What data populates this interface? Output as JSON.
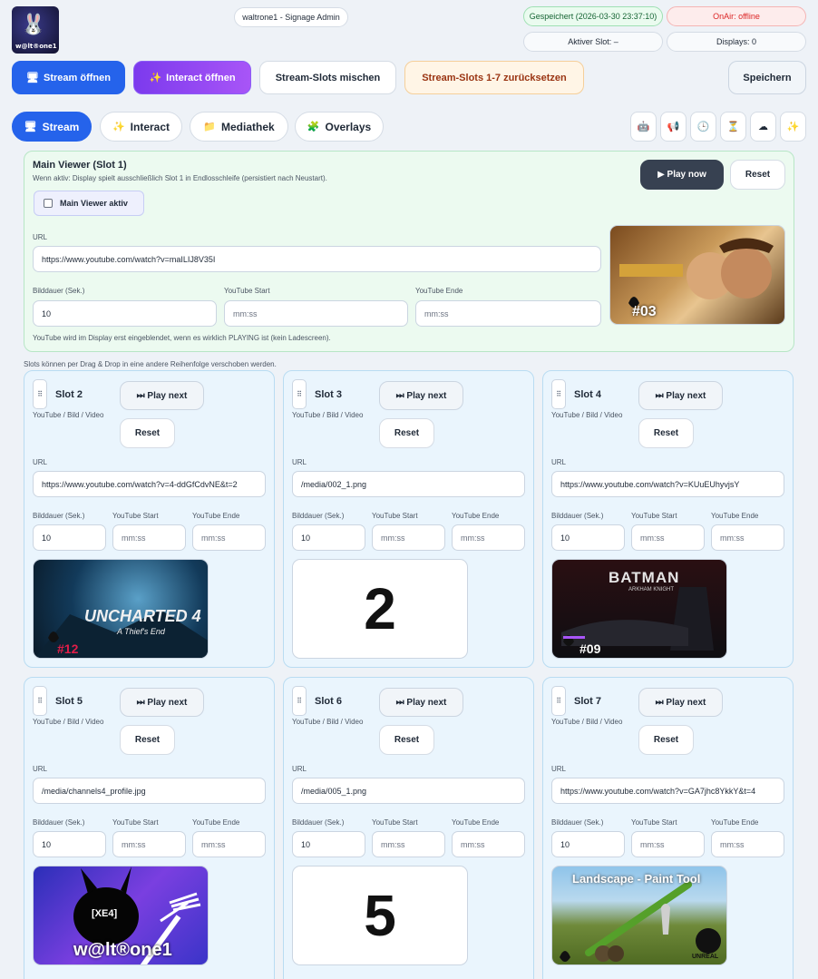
{
  "header": {
    "title": "waltrone1 - Signage Admin",
    "saved_status": "Gespeichert (2026-03-30 23:37:10)",
    "onair_status": "OnAir: offline",
    "active_slot": "Aktiver Slot: –",
    "displays": "Displays: 0",
    "logo_text": "w@lt®one1"
  },
  "toolbar": {
    "stream_open": "Stream öffnen",
    "interact_open": "Interact öffnen",
    "mix_slots": "Stream-Slots mischen",
    "reset_slots": "Stream-Slots 1-7 zurücksetzen",
    "save": "Speichern",
    "stream_open_icon": "monitor-icon",
    "interact_open_icon": "sparkle-icon"
  },
  "tabs": [
    {
      "label": "Stream",
      "icon": "monitor-icon",
      "active": true
    },
    {
      "label": "Interact",
      "icon": "sparkle-icon",
      "active": false
    },
    {
      "label": "Mediathek",
      "icon": "folder-icon",
      "active": false
    },
    {
      "label": "Overlays",
      "icon": "puzzle-icon",
      "active": false
    }
  ],
  "quick_icons": [
    "robot-icon",
    "megaphone-icon",
    "clock-icon",
    "hourglass-icon",
    "cloud-icon",
    "sparkle-icon"
  ],
  "main_viewer": {
    "title": "Main Viewer (Slot 1)",
    "subtitle": "Wenn aktiv: Display spielt ausschließlich Slot 1 in Endlosschleife (persistiert nach Neustart).",
    "checkbox_label": "Main Viewer aktiv",
    "play_now": "▶ Play now",
    "reset": "Reset",
    "url_label": "URL",
    "url": "https://www.youtube.com/watch?v=maILIJ8V35I",
    "duration_label": "Bilddauer (Sek.)",
    "duration": "10",
    "yt_start_label": "YouTube Start",
    "yt_start_placeholder": "mm:ss",
    "yt_end_label": "YouTube Ende",
    "yt_end_placeholder": "mm:ss",
    "hint": "YouTube wird im Display erst eingeblendet, wenn es wirklich PLAYING ist (kein Ladescreen).",
    "thumb_badge": "#03"
  },
  "slots_note": "Slots können per Drag & Drop in eine andere Reihenfolge verschoben werden.",
  "slot_common": {
    "type": "YouTube / Bild / Video",
    "play_next": "⏭ Play next",
    "reset": "Reset",
    "url_label": "URL",
    "duration_label": "Bilddauer (Sek.)",
    "yt_start_label": "YouTube Start",
    "yt_end_label": "YouTube Ende",
    "time_placeholder": "mm:ss"
  },
  "slots": [
    {
      "title": "Slot 2",
      "url": "https://www.youtube.com/watch?v=4-ddGfCdvNE&t=2",
      "duration": "10",
      "thumb_caption": "UNCHARTED 4",
      "thumb_sub": "A Thief's End",
      "thumb_badge": "#12"
    },
    {
      "title": "Slot 3",
      "url": "/media/002_1.png",
      "duration": "10",
      "thumb_caption": "2"
    },
    {
      "title": "Slot 4",
      "url": "https://www.youtube.com/watch?v=KUuEUhyvjsY",
      "duration": "10",
      "thumb_caption": "BATMAN",
      "thumb_sub": "ARKHAM KNIGHT",
      "thumb_badge": "#09"
    },
    {
      "title": "Slot 5",
      "url": "/media/channels4_profile.jpg",
      "duration": "10",
      "thumb_caption": "w@lt®one1",
      "thumb_sub": "[XE4]"
    },
    {
      "title": "Slot 6",
      "url": "/media/005_1.png",
      "duration": "10",
      "thumb_caption": "5"
    },
    {
      "title": "Slot 7",
      "url": "https://www.youtube.com/watch?v=GA7jhc8YkkY&t=4",
      "duration": "10",
      "thumb_caption": "Landscape - Paint Tool",
      "thumb_sub": "UNREAL"
    }
  ]
}
